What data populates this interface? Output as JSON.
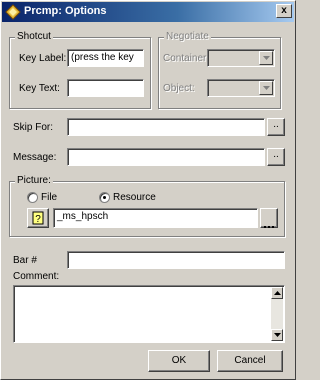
{
  "window": {
    "title": "Prcmp: Options",
    "close_glyph": "x"
  },
  "shotcut": {
    "group_label": "Shotcut",
    "key_label_label": "Key Label:",
    "key_label_value": "(press the key",
    "key_text_label": "Key Text:",
    "key_text_value": ""
  },
  "negotiate": {
    "group_label": "Negotiate",
    "container_label": "Container:",
    "object_label": "Object:"
  },
  "skip_for": {
    "label": "Skip For:",
    "value": "",
    "button": ".."
  },
  "message": {
    "label": "Message:",
    "value": "",
    "button": ".."
  },
  "picture": {
    "group_label": "Picture:",
    "radio_file": "File",
    "radio_resource": "Resource",
    "selected": "Resource",
    "value": "_ms_hpsch",
    "browse_button": ""
  },
  "bar": {
    "label": "Bar #",
    "value": ""
  },
  "comment": {
    "label": "Comment:",
    "value": ""
  },
  "buttons": {
    "ok": "OK",
    "cancel": "Cancel"
  }
}
